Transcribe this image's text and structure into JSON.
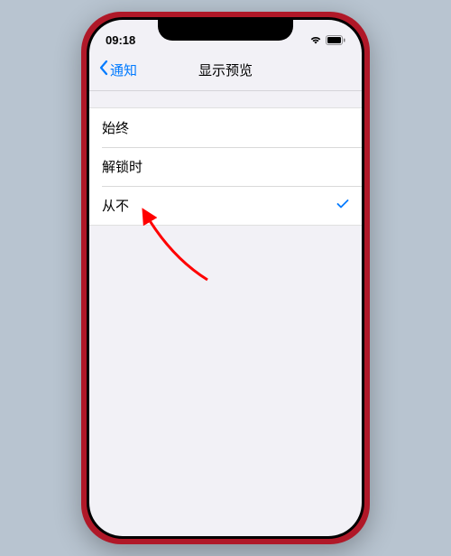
{
  "statusBar": {
    "time": "09:18"
  },
  "navBar": {
    "backLabel": "通知",
    "title": "显示预览"
  },
  "options": {
    "always": "始终",
    "whenUnlocked": "解锁时",
    "never": "从不"
  },
  "selectedOption": "never"
}
